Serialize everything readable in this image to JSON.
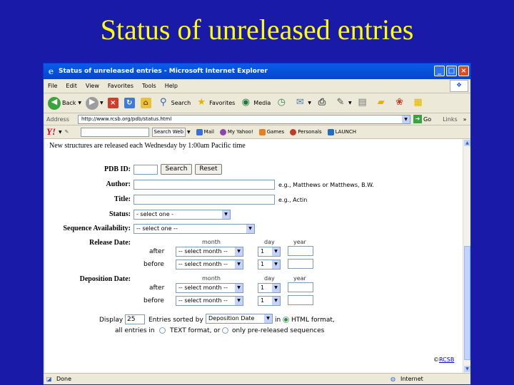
{
  "slide_title": "Status of unreleased entries",
  "window": {
    "title": "Status of unreleased entries - Microsoft Internet Explorer",
    "controls": [
      "_",
      "□",
      "×"
    ]
  },
  "menu": [
    "File",
    "Edit",
    "View",
    "Favorites",
    "Tools",
    "Help"
  ],
  "toolbar": {
    "back": "Back",
    "search": "Search",
    "favorites": "Favorites",
    "media": "Media"
  },
  "address": {
    "label": "Address",
    "url": "http://www.rcsb.org/pdb/status.html",
    "go": "Go",
    "links": "Links"
  },
  "yahoo": {
    "search_web": "Search Web",
    "items": [
      "Mail",
      "My Yahoo!",
      "Games",
      "Personals",
      "LAUNCH"
    ]
  },
  "form": {
    "intro": "New structures are released each Wednesday by 1:00am Pacific time",
    "pdbid_label": "PDB ID:",
    "search_button": "Search",
    "reset_button": "Reset",
    "author_label": "Author:",
    "author_hint": "e.g., Matthews or Matthews, B.W.",
    "title_label": "Title:",
    "title_hint": "e.g., Actin",
    "status_label": "Status:",
    "status_value": "- select one -",
    "seqavail_label": "Sequence Availability:",
    "seqavail_value": "-- select one --",
    "release_label": "Release Date:",
    "deposition_label": "Deposition Date:",
    "col_month": "month",
    "col_day": "day",
    "col_year": "year",
    "after": "after",
    "before": "before",
    "month_value": "-- select month --",
    "day_value": "1",
    "display_prefix": "Display",
    "display_count": "25",
    "entries_sorted_by": "Entries sorted by",
    "sort_value": "Deposition Date",
    "in": "in",
    "html_format": "HTML format,",
    "all_entries_in": "all entries in",
    "text_format_or": "TEXT format, or",
    "only_prereleased": "only pre-released sequences",
    "copyright_symbol": "©",
    "copyright_link": "RCSB"
  },
  "status": {
    "left": "Done",
    "zone": "Internet"
  }
}
